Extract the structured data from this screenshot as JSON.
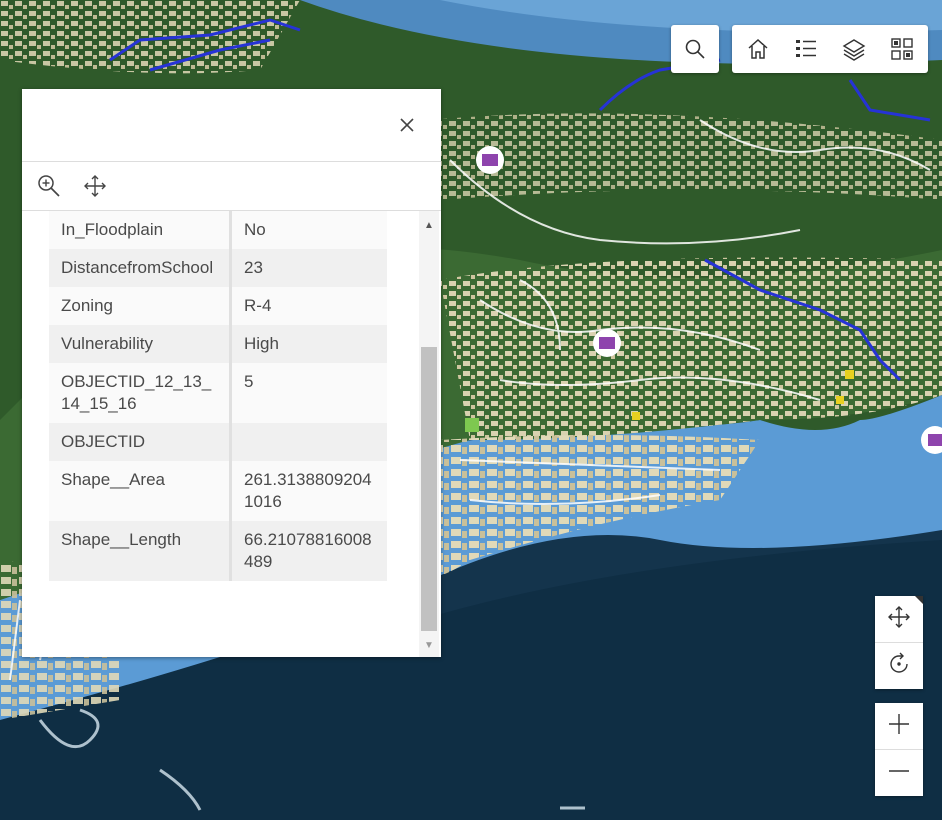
{
  "toolbar": {
    "search": "search-icon",
    "buttons": [
      "home-icon",
      "legend-icon",
      "layers-icon",
      "basemap-gallery-icon"
    ]
  },
  "popup": {
    "close_icon": "close-icon",
    "actions": [
      "zoom-to-icon",
      "pan-icon"
    ],
    "fields": [
      {
        "key": "In_Floodplain",
        "value": "No"
      },
      {
        "key": "DistancefromSchool",
        "value": "23"
      },
      {
        "key": "Zoning",
        "value": "R-4"
      },
      {
        "key": "Vulnerability",
        "value": "High"
      },
      {
        "key": "OBJECTID_12_13_14_15_16",
        "value": "5"
      },
      {
        "key": "OBJECTID",
        "value": ""
      },
      {
        "key": "Shape__Area",
        "value": "261.31388092041016"
      },
      {
        "key": "Shape__Length",
        "value": "66.21078816008489"
      }
    ]
  },
  "navigation": {
    "controls": [
      "pan-icon",
      "rotate-icon"
    ],
    "zoom": [
      "zoom-in-icon",
      "zoom-out-icon"
    ]
  },
  "colors": {
    "water": "#5b9bd5",
    "deep_water": "#0e3a55",
    "terrain": "#2f5a2a",
    "buildings": "#d9d2b0",
    "school_icon": "#8e44ad"
  }
}
